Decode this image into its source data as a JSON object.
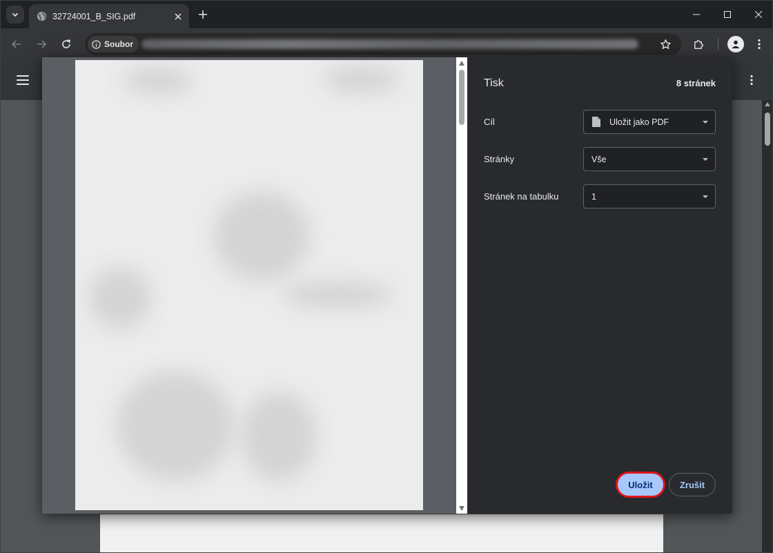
{
  "tab": {
    "title": "32724001_B_SIG.pdf"
  },
  "toolbar": {
    "site_chip_label": "Soubor"
  },
  "print_dialog": {
    "title": "Tisk",
    "page_count": "8 stránek",
    "destination_label": "Cíl",
    "destination_value": "Uložit jako PDF",
    "pages_label": "Stránky",
    "pages_value": "Vše",
    "pages_per_sheet_label": "Stránek na tabulku",
    "pages_per_sheet_value": "1",
    "save_label": "Uložit",
    "cancel_label": "Zrušit"
  },
  "colors": {
    "accent": "#a8c7fa",
    "highlight": "#e1141b"
  }
}
